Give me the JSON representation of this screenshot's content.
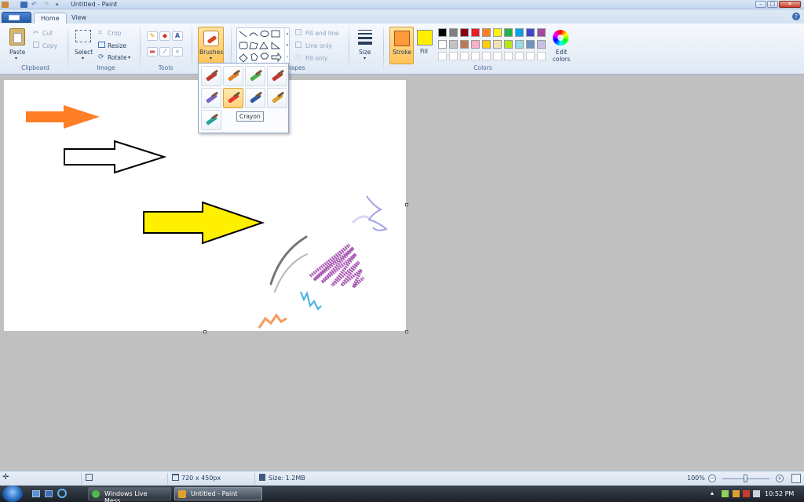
{
  "window": {
    "title": "Untitled - Paint"
  },
  "tabs": [
    {
      "label": "Home",
      "active": true
    },
    {
      "label": "View",
      "active": false
    }
  ],
  "ribbon": {
    "clipboard": {
      "label": "Clipboard",
      "paste": "Paste",
      "cut": "Cut",
      "copy": "Copy"
    },
    "image": {
      "label": "Image",
      "select": "Select",
      "crop": "Crop",
      "resize": "Resize",
      "rotate": "Rotate"
    },
    "tools": {
      "label": "Tools",
      "text_tool": "A"
    },
    "brushes": {
      "label": "Brushes"
    },
    "shapes": {
      "label": "Shapes",
      "fill_and_line": "Fill and line",
      "line_only": "Line only",
      "fill_only": "Fill only"
    },
    "size": {
      "label": "Size"
    },
    "stroke": {
      "label": "Stroke",
      "color": "#ff9a3c"
    },
    "fill": {
      "label": "Fill",
      "color": "#ffef00"
    },
    "colors": {
      "label": "Colors",
      "edit_colors": "Edit colors",
      "row1": [
        "#000000",
        "#7f7f7f",
        "#880015",
        "#ed1c24",
        "#ff7f27",
        "#fff200",
        "#22b14c",
        "#00a2e8",
        "#3f48cc",
        "#a349a4"
      ],
      "row2": [
        "#ffffff",
        "#c3c3c3",
        "#b97a57",
        "#ffaec9",
        "#ffc90e",
        "#efe4b0",
        "#b5e61d",
        "#99d9ea",
        "#7092be",
        "#c8bfe7"
      ],
      "row3": [
        "#ffffff",
        "#ffffff",
        "#ffffff",
        "#ffffff",
        "#ffffff",
        "#ffffff",
        "#ffffff",
        "#ffffff",
        "#ffffff",
        "#ffffff"
      ]
    }
  },
  "brushes_menu": {
    "items": [
      {
        "name": "brush-icon",
        "color": "#c0392b"
      },
      {
        "name": "calligraphy-brush-1-icon",
        "color": "#e67e22"
      },
      {
        "name": "calligraphy-brush-2-icon",
        "color": "#4caf50"
      },
      {
        "name": "airbrush-icon",
        "color": "#c0392b"
      },
      {
        "name": "oil-brush-icon",
        "color": "#7a64c8"
      },
      {
        "name": "crayon-icon",
        "color": "#e53935",
        "selected": true
      },
      {
        "name": "marker-icon",
        "color": "#2c5aa0"
      },
      {
        "name": "natural-pencil-icon",
        "color": "#e0a030"
      },
      {
        "name": "watercolor-brush-icon",
        "color": "#26a69a"
      }
    ],
    "tooltip": "Crayon"
  },
  "statusbar": {
    "dimensions": "720 x 450px",
    "size": "Size: 1.2MB",
    "zoom": "100%"
  },
  "taskbar": {
    "buttons": [
      {
        "label": "Windows Live Mess..."
      },
      {
        "label": "Untitled - Paint",
        "active": true
      }
    ],
    "clock": "10:52 PM"
  }
}
